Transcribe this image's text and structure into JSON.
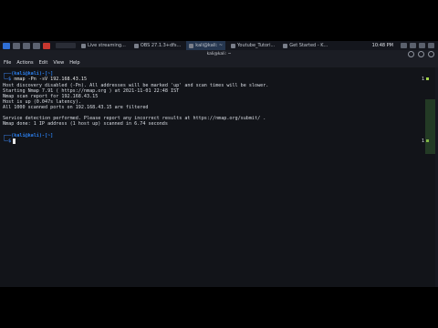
{
  "taskbar": {
    "tasks": [
      {
        "label": "Live streaming..."
      },
      {
        "label": "OBS 27.1.3+dfs..."
      },
      {
        "label": "kali@kali: ~"
      },
      {
        "label": "Youtube_Tutori..."
      },
      {
        "label": "Get Started - K..."
      }
    ],
    "clock": "10:48 PM"
  },
  "window": {
    "title": "kali@kali: ~",
    "menu": [
      "File",
      "Actions",
      "Edit",
      "View",
      "Help"
    ]
  },
  "terminal": {
    "prompt1_user": "(kali@kali)-[~]",
    "prompt1_cmd": "nmap -Pn -sV 192.168.43.15",
    "output": [
      "Host discovery disabled (-Pn). All addresses will be marked 'up' and scan times will be slower.",
      "Starting Nmap 7.91 ( https://nmap.org ) at 2021-11-01 22:48 IST",
      "Nmap scan report for 192.168.43.15",
      "Host is up (0.047s latency).",
      "All 1000 scanned ports on 192.168.43.15 are filtered",
      "",
      "Service detection performed. Please report any incorrect results at https://nmap.org/submit/ .",
      "Nmap done: 1 IP address (1 host up) scanned in 6.74 seconds"
    ],
    "prompt2_user": "(kali@kali)-[~]",
    "exit_indicator_1": "1",
    "exit_indicator_2": "1"
  },
  "colors": {
    "terminal_bg": "#121419",
    "prompt": "#2b7de9",
    "text": "#d9dde4"
  }
}
